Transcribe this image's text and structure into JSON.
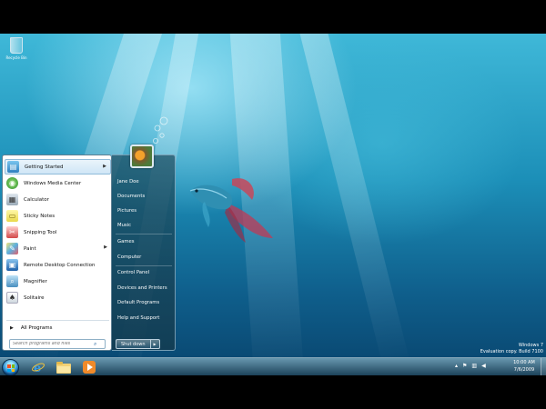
{
  "desktop": {
    "recycle_bin_label": "Recycle Bin",
    "watermark": {
      "line1": "Windows 7",
      "line2": "Evaluation copy. Build 7100"
    }
  },
  "start_menu": {
    "programs": [
      {
        "label": "Getting Started",
        "icon": "getting-started-icon",
        "has_submenu": true
      },
      {
        "label": "Windows Media Center",
        "icon": "media-center-icon",
        "has_submenu": false
      },
      {
        "label": "Calculator",
        "icon": "calculator-icon",
        "has_submenu": false
      },
      {
        "label": "Sticky Notes",
        "icon": "sticky-notes-icon",
        "has_submenu": false
      },
      {
        "label": "Snipping Tool",
        "icon": "snipping-tool-icon",
        "has_submenu": false
      },
      {
        "label": "Paint",
        "icon": "paint-icon",
        "has_submenu": true
      },
      {
        "label": "Remote Desktop Connection",
        "icon": "remote-desktop-icon",
        "has_submenu": false
      },
      {
        "label": "Magnifier",
        "icon": "magnifier-icon",
        "has_submenu": false
      },
      {
        "label": "Solitaire",
        "icon": "solitaire-icon",
        "has_submenu": false
      }
    ],
    "all_programs_label": "All Programs",
    "search_placeholder": "Search programs and files",
    "right_links": [
      "Jane Doe",
      "Documents",
      "Pictures",
      "Music",
      "Games",
      "Computer",
      "Control Panel",
      "Devices and Printers",
      "Default Programs",
      "Help and Support"
    ],
    "shutdown_label": "Shut down"
  },
  "taskbar": {
    "pinned": [
      "internet-explorer-icon",
      "windows-explorer-icon",
      "media-player-icon"
    ],
    "clock_time": "10:00 AM",
    "clock_date": "7/6/2009"
  },
  "colors": {
    "accent": "#1c8fb8",
    "taskbar": "#2a5f80"
  }
}
